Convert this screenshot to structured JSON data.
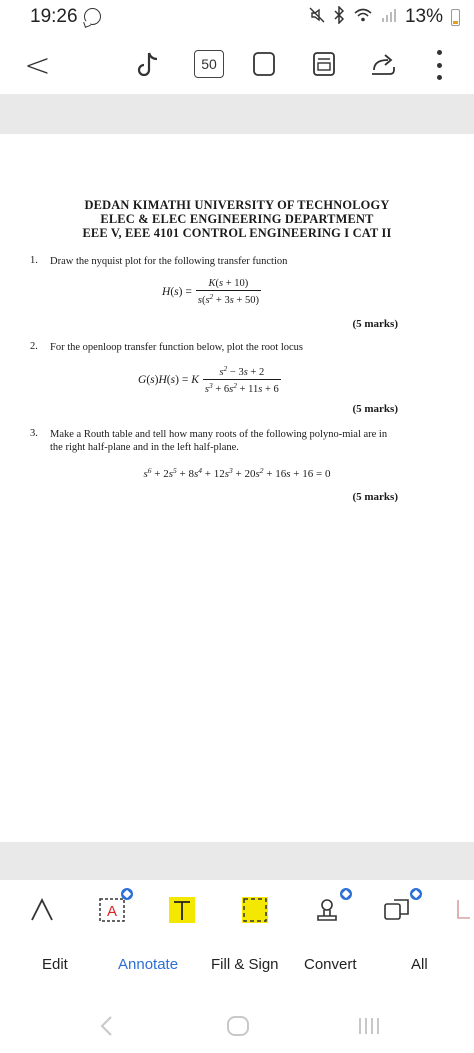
{
  "status_bar": {
    "time": "19:26",
    "battery": "13%",
    "icons": [
      "whatsapp-icon",
      "mute-icon",
      "bluetooth-icon",
      "wifi-icon",
      "signal-icon",
      "battery-icon"
    ]
  },
  "toolbar": {
    "page_count": "50",
    "icons": [
      "back-icon",
      "tiktok-icon",
      "pages-icon",
      "fullscreen-icon",
      "reader-mode-icon",
      "share-icon",
      "more-icon"
    ]
  },
  "document": {
    "header_line1": "DEDAN KIMATHI UNIVERSITY OF TECHNOLOGY",
    "header_line2": "ELEC & ELEC ENGINEERING DEPARTMENT",
    "header_line3": "EEE V, EEE 4101 CONTROL ENGINEERING I CAT II",
    "questions": [
      {
        "number": "1.",
        "text": "Draw the nyquist plot for the following transfer function",
        "marks": "(5 marks)"
      },
      {
        "number": "2.",
        "text": "For the openloop transfer function below, plot the root locus",
        "marks": "(5 marks)"
      },
      {
        "number": "3.",
        "text": "Make a Routh table and tell how many roots of the following polyno-mial are in the right half-plane and in the left half-plane.",
        "marks": "(5 marks)"
      }
    ]
  },
  "bottom_tools": {
    "icons": [
      "draw-icon",
      "text-box-icon",
      "text-icon",
      "fill-area-icon",
      "sign-icon",
      "convert-shapes-icon",
      "more-tools-icon"
    ]
  },
  "bottom_nav": {
    "items": [
      "Edit",
      "Annotate",
      "Fill & Sign",
      "Convert",
      "All"
    ],
    "active": "Annotate"
  },
  "colors": {
    "accent": "#2c6fd6",
    "highlight": "#f5e800",
    "band": "#e9e9e9"
  }
}
